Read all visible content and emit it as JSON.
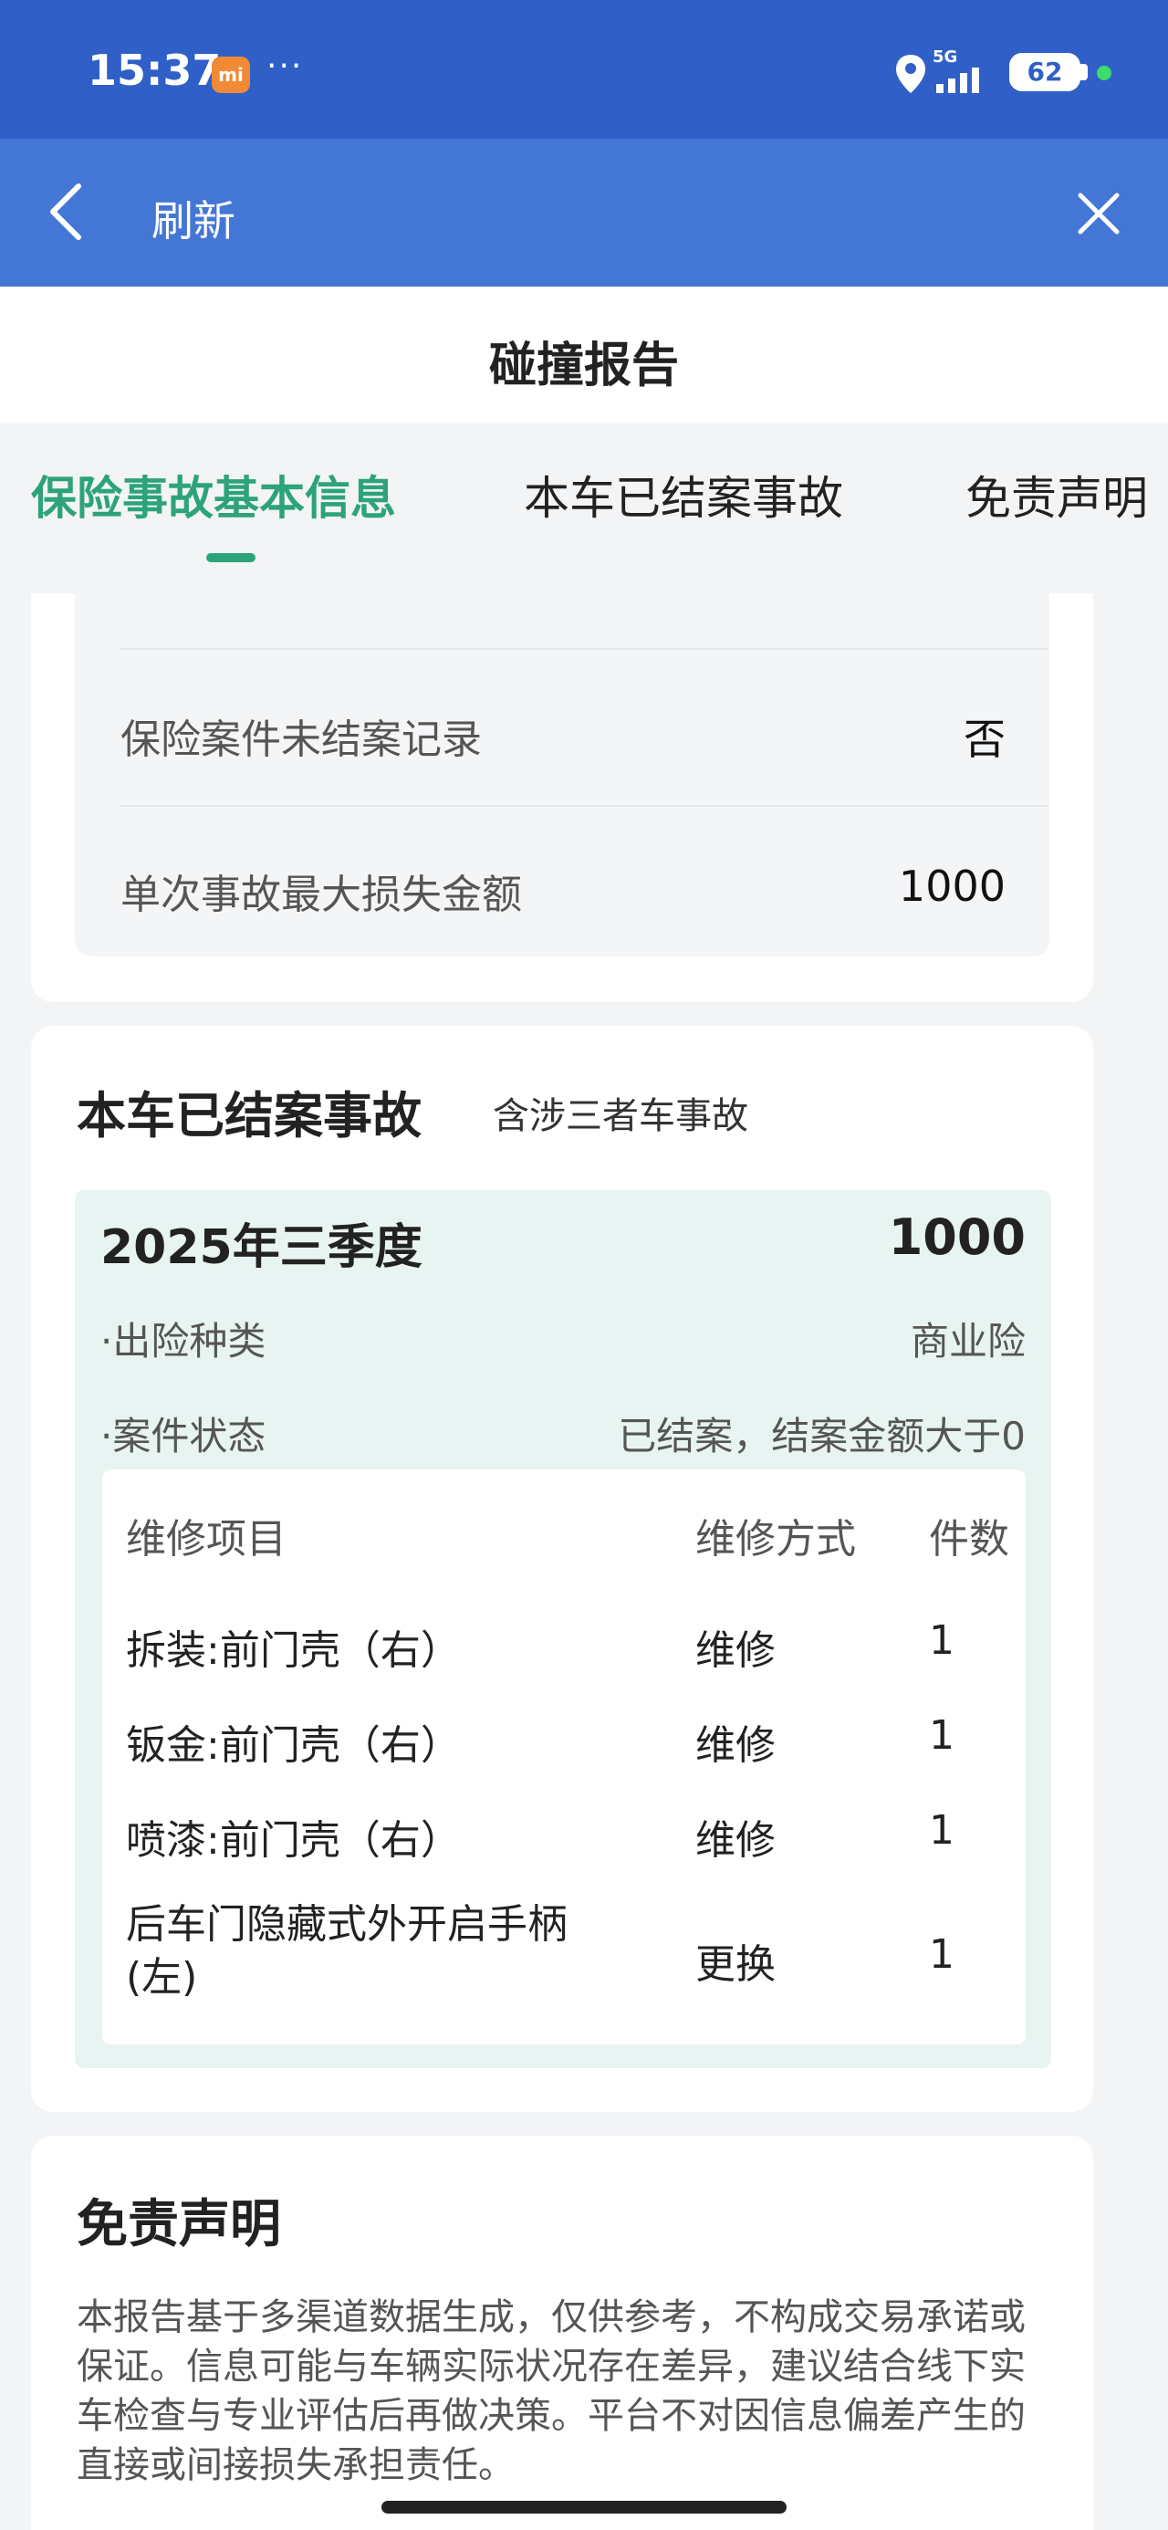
{
  "status_bar": {
    "time": "15:37",
    "app_badge": "mi",
    "more": "···",
    "network": "5G",
    "battery": "62"
  },
  "nav": {
    "title": "刷新"
  },
  "page": {
    "title": "碰撞报告"
  },
  "tabs": [
    {
      "label": "保险事故基本信息",
      "active": true
    },
    {
      "label": "本车已结案事故",
      "active": false
    },
    {
      "label": "免责声明",
      "active": false
    }
  ],
  "basic_info": {
    "rows": [
      {
        "label": "保险案件未结案记录",
        "value": "否"
      },
      {
        "label": "单次事故最大损失金额",
        "value": "1000"
      }
    ]
  },
  "closed_claims": {
    "title": "本车已结案事故",
    "subtitle": "含涉三者车事故",
    "claim": {
      "quarter": "2025年三季度",
      "amount": "1000",
      "fields": [
        {
          "label": "·出险种类",
          "value": "商业险"
        },
        {
          "label": "·案件状态",
          "value": "已结案，结案金额大于0"
        }
      ],
      "table": {
        "headers": [
          "维修项目",
          "维修方式",
          "件数"
        ],
        "rows": [
          {
            "item": "拆装:前门壳（右）",
            "method": "维修",
            "count": "1"
          },
          {
            "item": "钣金:前门壳（右）",
            "method": "维修",
            "count": "1"
          },
          {
            "item": "喷漆:前门壳（右）",
            "method": "维修",
            "count": "1"
          },
          {
            "item": "后车门隐藏式外开启手柄(左)",
            "method": "更换",
            "count": "1"
          }
        ]
      }
    }
  },
  "disclaimer": {
    "title": "免责声明",
    "text": "本报告基于多渠道数据生成，仅供参考，不构成交易承诺或保证。信息可能与车辆实际状况存在差异，建议结合线下实车检查与专业评估后再做决策。平台不对因信息偏差产生的直接或间接损失承担责任。"
  }
}
